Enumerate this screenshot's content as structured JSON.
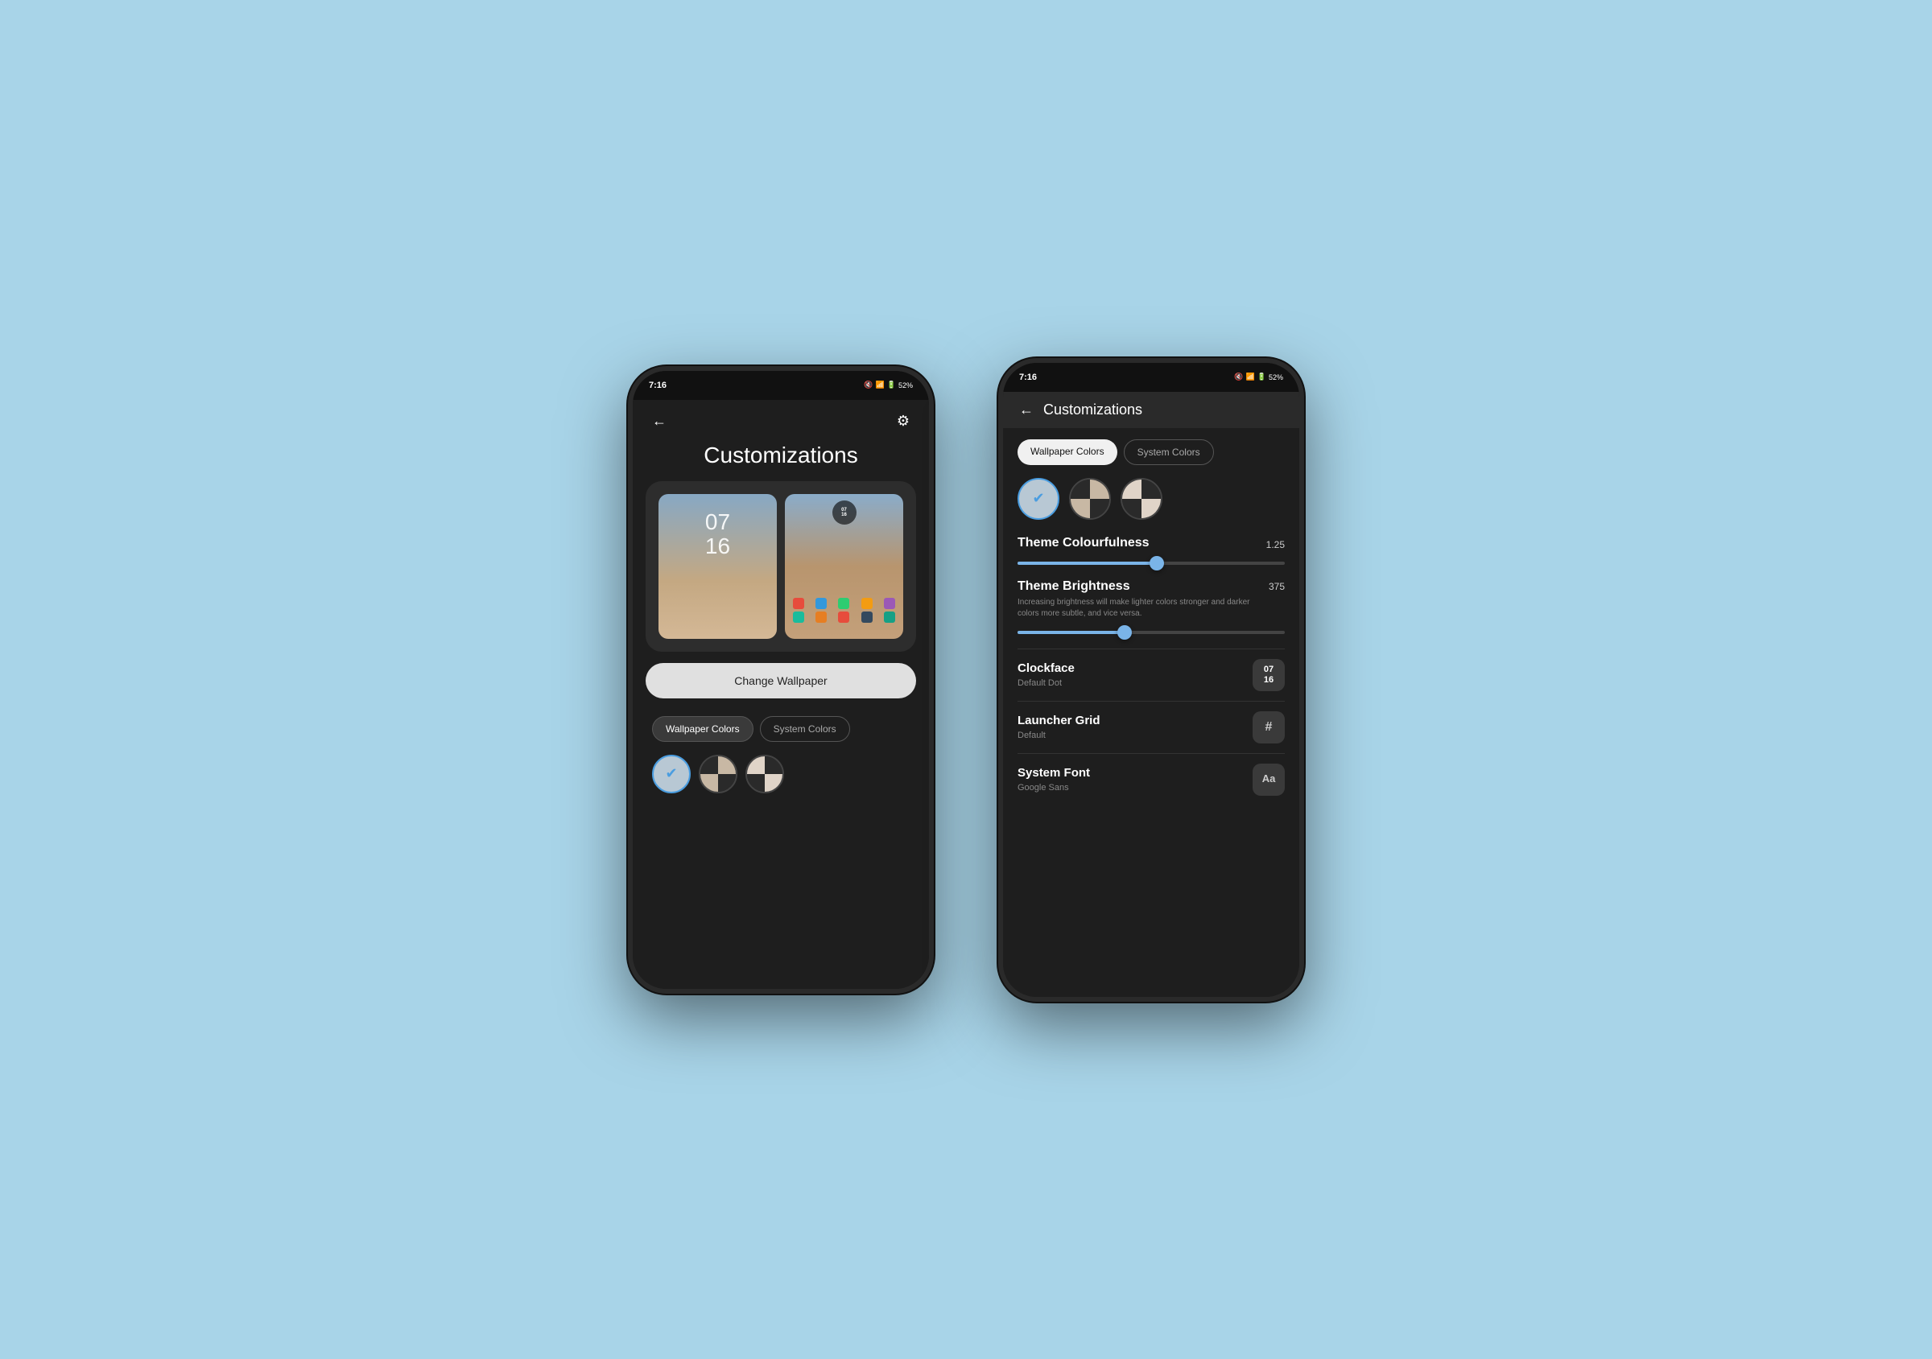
{
  "background_color": "#a8d4e8",
  "phone1": {
    "status_time": "7:16",
    "status_icons": "🔇 📶 🔋 52%",
    "back_label": "←",
    "settings_label": "⚙",
    "title": "Customizations",
    "change_wallpaper_btn": "Change Wallpaper",
    "tabs": [
      {
        "label": "Wallpaper Colors",
        "active": true
      },
      {
        "label": "System Colors",
        "active": false
      }
    ],
    "lock_time": "07\n16",
    "home_clock": "07\n16"
  },
  "phone2": {
    "status_time": "7:16",
    "status_icons": "🔇 📶 🔋 52%",
    "back_label": "←",
    "title": "Customizations",
    "tabs": [
      {
        "label": "Wallpaper Colors",
        "active": true
      },
      {
        "label": "System Colors",
        "active": false
      }
    ],
    "theme_colourfulness_label": "Theme Colourfulness",
    "theme_colourfulness_value": "1.25",
    "theme_colourfulness_pct": 52,
    "theme_brightness_label": "Theme Brightness",
    "theme_brightness_value": "375",
    "theme_brightness_pct": 40,
    "theme_brightness_desc": "Increasing brightness will make lighter colors stronger and darker colors more subtle, and vice versa.",
    "clockface_label": "Clockface",
    "clockface_sub": "Default Dot",
    "clockface_icon": "07\n16",
    "launcher_grid_label": "Launcher Grid",
    "launcher_grid_sub": "Default",
    "launcher_grid_icon": "#",
    "system_font_label": "System Font",
    "system_font_sub": "Google Sans",
    "system_font_icon": "Aa"
  }
}
